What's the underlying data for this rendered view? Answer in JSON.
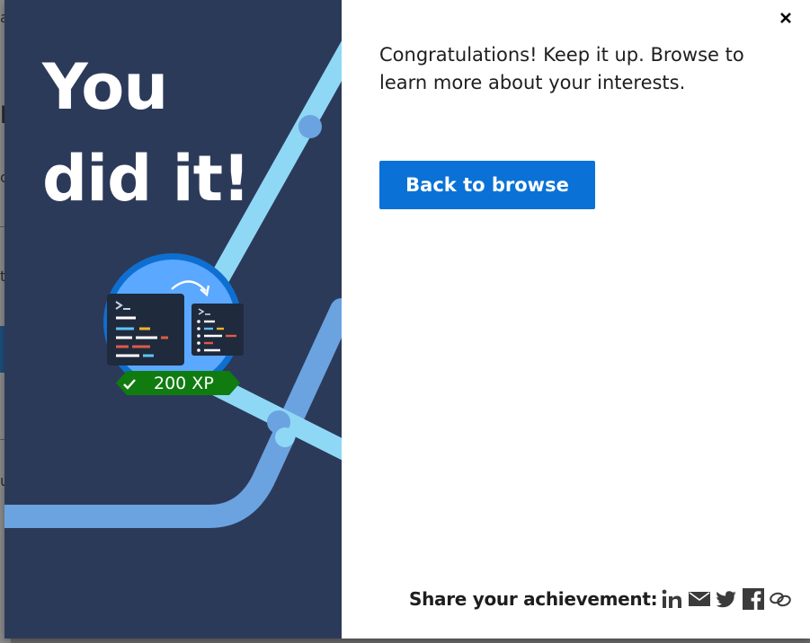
{
  "modal": {
    "title_line_1": "You",
    "title_line_2": "did it!",
    "badge": {
      "xp_label": "200 XP",
      "badge_icon": "terminal-migration-icon"
    },
    "message": "Congratulations! Keep it up. Browse to learn more about your interests.",
    "primary_button_label": "Back to browse",
    "close_icon": "close-icon"
  },
  "share": {
    "label": "Share your achievement:",
    "icons": [
      "linkedin-icon",
      "email-icon",
      "twitter-icon",
      "facebook-icon",
      "copy-link-icon"
    ]
  },
  "colors": {
    "hero_background": "#2c3a5a",
    "primary_button": "#0a72d6",
    "xp_ribbon": "#107c10",
    "track_light": "#8fd8f5",
    "track_mid": "#6ba3e0"
  }
}
